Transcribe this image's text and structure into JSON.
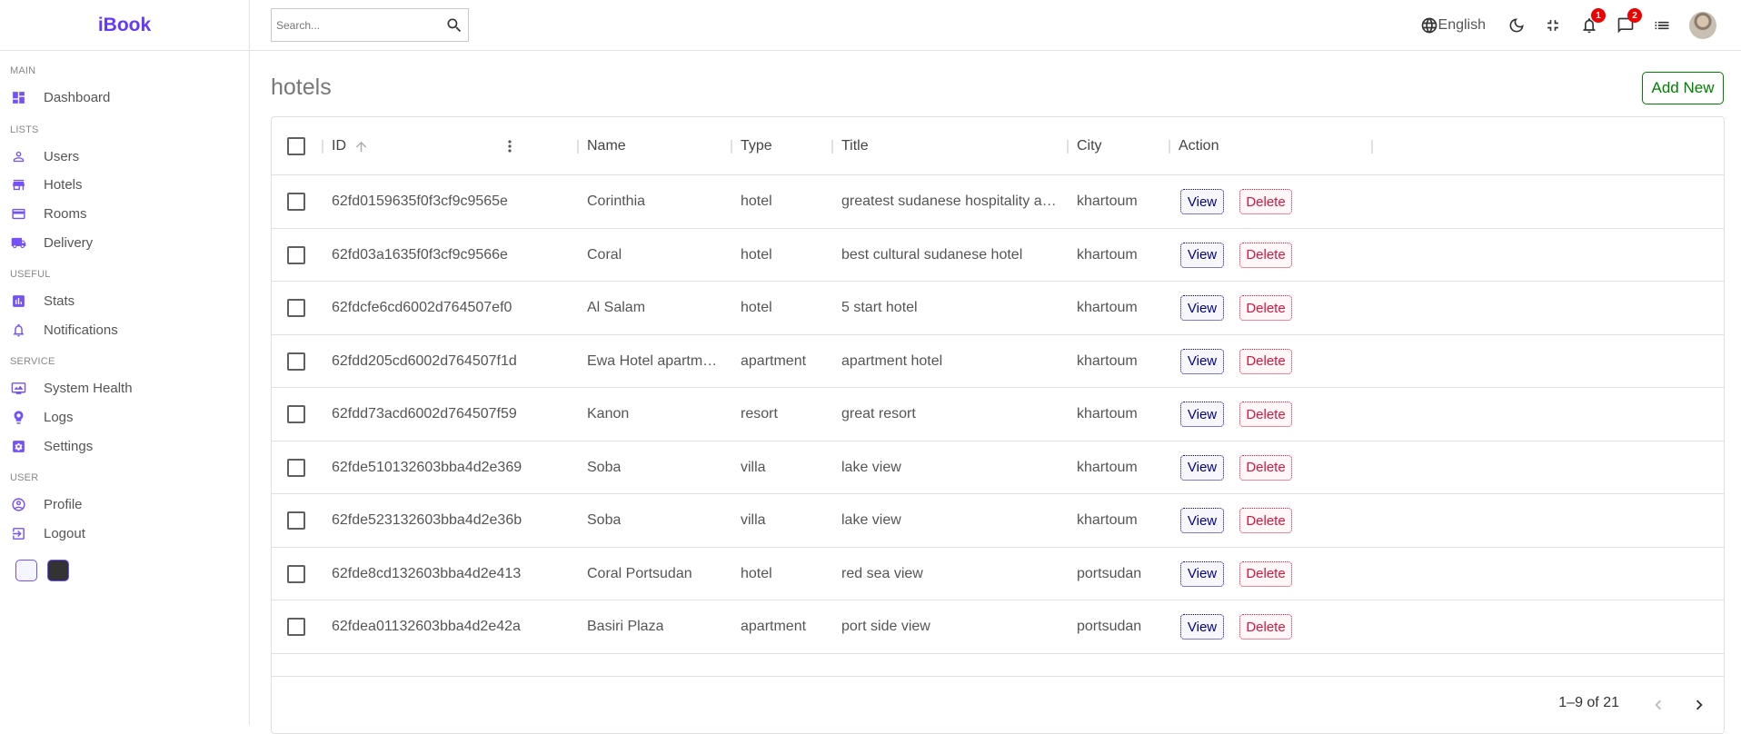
{
  "app": {
    "logo": "iBook"
  },
  "sidebar": {
    "sections": [
      {
        "title": "MAIN",
        "items": [
          {
            "label": "Dashboard",
            "icon": "dashboard-icon"
          }
        ]
      },
      {
        "title": "LISTS",
        "items": [
          {
            "label": "Users",
            "icon": "person-icon"
          },
          {
            "label": "Hotels",
            "icon": "store-icon"
          },
          {
            "label": "Rooms",
            "icon": "credit-card-icon"
          },
          {
            "label": "Delivery",
            "icon": "truck-icon"
          }
        ]
      },
      {
        "title": "USEFUL",
        "items": [
          {
            "label": "Stats",
            "icon": "bar-chart-icon"
          },
          {
            "label": "Notifications",
            "icon": "bell-icon"
          }
        ]
      },
      {
        "title": "SERVICE",
        "items": [
          {
            "label": "System Health",
            "icon": "monitor-icon"
          },
          {
            "label": "Logs",
            "icon": "psychology-icon"
          },
          {
            "label": "Settings",
            "icon": "settings-icon"
          }
        ]
      },
      {
        "title": "USER",
        "items": [
          {
            "label": "Profile",
            "icon": "account-circle-icon"
          },
          {
            "label": "Logout",
            "icon": "logout-icon"
          }
        ]
      }
    ],
    "color_options": [
      "#f5f5ff",
      "#333333"
    ]
  },
  "navbar": {
    "search_placeholder": "Search...",
    "language": "English",
    "notifications_count": "1",
    "messages_count": "2"
  },
  "page": {
    "title": "hotels",
    "add_new_label": "Add New"
  },
  "table": {
    "columns": [
      "ID",
      "Name",
      "Type",
      "Title",
      "City",
      "Action"
    ],
    "view_label": "View",
    "delete_label": "Delete",
    "rows": [
      {
        "id": "62fd0159635f0f3cf9c9565e",
        "name": "Corinthia",
        "type": "hotel",
        "title": "greatest sudanese hospitality a…",
        "city": "khartoum"
      },
      {
        "id": "62fd03a1635f0f3cf9c9566e",
        "name": "Coral",
        "type": "hotel",
        "title": "best cultural sudanese hotel",
        "city": "khartoum"
      },
      {
        "id": "62fdcfe6cd6002d764507ef0",
        "name": "Al Salam",
        "type": "hotel",
        "title": "5 start hotel",
        "city": "khartoum"
      },
      {
        "id": "62fdd205cd6002d764507f1d",
        "name": "Ewa Hotel apartm…",
        "type": "apartment",
        "title": "apartment hotel",
        "city": "khartoum"
      },
      {
        "id": "62fdd73acd6002d764507f59",
        "name": "Kanon",
        "type": "resort",
        "title": "great resort",
        "city": "khartoum"
      },
      {
        "id": "62fde510132603bba4d2e369",
        "name": "Soba",
        "type": "villa",
        "title": "lake view",
        "city": "khartoum"
      },
      {
        "id": "62fde523132603bba4d2e36b",
        "name": "Soba",
        "type": "villa",
        "title": "lake view",
        "city": "khartoum"
      },
      {
        "id": "62fde8cd132603bba4d2e413",
        "name": "Coral Portsudan",
        "type": "hotel",
        "title": "red sea view",
        "city": "portsudan"
      },
      {
        "id": "62fdea01132603bba4d2e42a",
        "name": "Basiri Plaza",
        "type": "apartment",
        "title": "port side view",
        "city": "portsudan"
      }
    ],
    "pagination": "1–9 of 21"
  }
}
